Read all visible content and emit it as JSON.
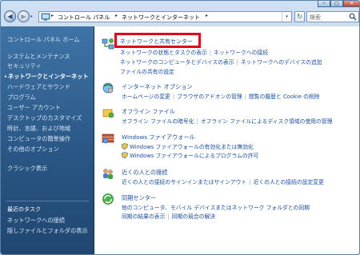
{
  "window": {
    "minimize_label": "─",
    "maximize_label": "□",
    "close_label": "✕"
  },
  "nav": {
    "back_label": "◀",
    "forward_label": "▶",
    "history_label": "▾",
    "refresh_label": "↻",
    "address_crumbs": [
      "コントロール パネル",
      "ネットワークとインターネット"
    ],
    "address_sep": "▸",
    "address_drop": "▾",
    "search_placeholder": "検索"
  },
  "sidebar": {
    "home": "コントロール パネル ホーム",
    "items": [
      {
        "label": "システムとメンテナンス",
        "active": false
      },
      {
        "label": "セキュリティ",
        "active": false
      },
      {
        "label": "ネットワークとインターネット",
        "active": true
      },
      {
        "label": "ハードウェアとサウンド",
        "active": false
      },
      {
        "label": "プログラム",
        "active": false
      },
      {
        "label": "ユーザー アカウント",
        "active": false
      },
      {
        "label": "デスクトップのカスタマイズ",
        "active": false
      },
      {
        "label": "時計、言語、および地域",
        "active": false
      },
      {
        "label": "コンピュータの簡単操作",
        "active": false
      },
      {
        "label": "その他のオプション",
        "active": false
      }
    ],
    "active_marker": "•",
    "classic_view": "クラシック表示",
    "recent_tasks_heading": "最近のタスク",
    "recent_tasks": [
      "ネットワークへの接続",
      "隠しファイルとフォルダの表示"
    ]
  },
  "sections": {
    "network_center": {
      "title": "ネットワークと共有センター",
      "row1": [
        "ネットワークの状態とタスクの表示",
        "ネットワークへの接続"
      ],
      "row2": [
        "ネットワークのコンピュータとデバイスの表示",
        "ネットワークへのデバイスの追加"
      ],
      "row3": [
        "ファイルの共有の設定"
      ]
    },
    "internet_options": {
      "title": "インターネット オプション",
      "row1": [
        "ホームページの変更",
        "ブラウザのアドオンの管理",
        "閲覧の履歴と Cookie の削除"
      ]
    },
    "offline_files": {
      "title": "オフライン ファイル",
      "row1": [
        "オフライン ファイルの暗号化",
        "オフライン ファイルによるディスク領域の使用の管理"
      ]
    },
    "firewall": {
      "title": "Windows ファイアウォール",
      "row1": [
        "Windows ファイアウォールの有効化または無効化"
      ],
      "row2": [
        "Windows ファイアウォールによるプログラムの許可"
      ]
    },
    "people_near_me": {
      "title": "近くの人との接続",
      "row1": [
        "近くの人との接続のサインインまたはサインアウト",
        "近くの人との接続の設定変更"
      ]
    },
    "sync_center": {
      "title": "同期センター",
      "row1": [
        "他のコンピュータ、モバイル デバイスまたはネットワーク フォルダとの同期"
      ],
      "row2": [
        "同期の結果の表示",
        "同期の競合の解決"
      ]
    }
  },
  "colors": {
    "link": "#1b4fa0",
    "highlight": "#e1001a",
    "sidebar_bg": "#2a5785"
  }
}
